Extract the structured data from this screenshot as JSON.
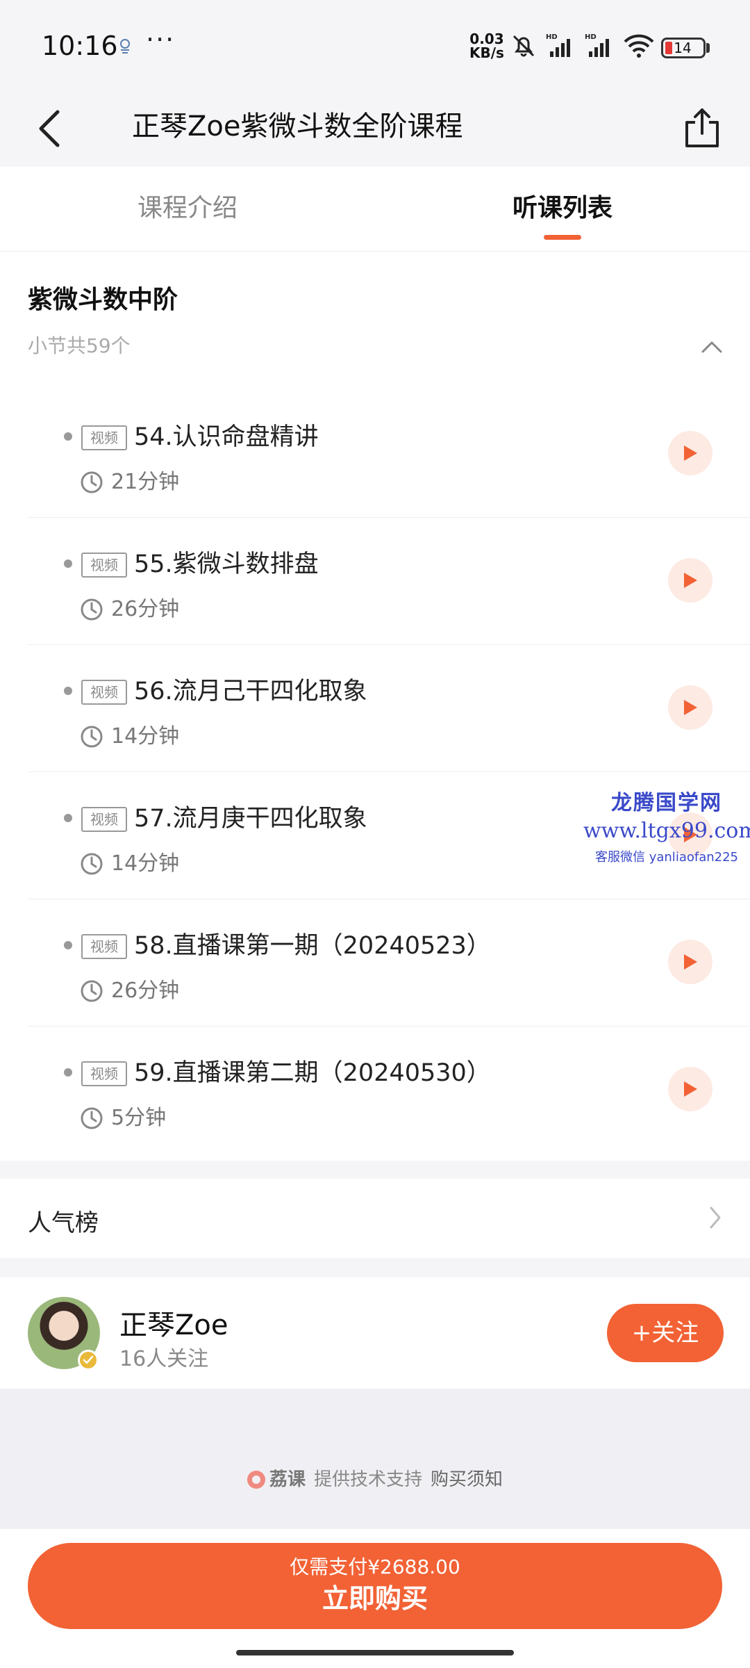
{
  "status_bar": {
    "time": "10:16",
    "more": "···",
    "net_speed_value": "0.03",
    "net_speed_unit": "KB/s",
    "battery": "14",
    "icons": [
      "weather-icon",
      "mute-bell-icon",
      "hd-signal-icon",
      "hd-signal-icon",
      "wifi-icon",
      "battery-icon"
    ]
  },
  "header": {
    "title": "正琴Zoe紫微斗数全阶课程"
  },
  "tabs": [
    {
      "label": "课程介绍",
      "active": false
    },
    {
      "label": "听课列表",
      "active": true
    }
  ],
  "chapter": {
    "title": "紫微斗数中阶",
    "count": "小节共59个",
    "lessons": [
      {
        "tag": "视频",
        "title": "54.认识命盘精讲",
        "duration": "21分钟"
      },
      {
        "tag": "视频",
        "title": "55.紫微斗数排盘",
        "duration": "26分钟"
      },
      {
        "tag": "视频",
        "title": "56.流月己干四化取象",
        "duration": "14分钟"
      },
      {
        "tag": "视频",
        "title": "57.流月庚干四化取象",
        "duration": "14分钟"
      },
      {
        "tag": "视频",
        "title": "58.直播课第一期（20240523）",
        "duration": "26分钟"
      },
      {
        "tag": "视频",
        "title": "59.直播课第二期（20240530）",
        "duration": "5分钟"
      }
    ]
  },
  "watermark": {
    "line1": "龙腾国学网",
    "line2": "www.ltgx99.com",
    "line3": "客服微信 yanliaofan225"
  },
  "popular": {
    "label": "人气榜"
  },
  "author": {
    "name": "正琴Zoe",
    "followers": "16人关注",
    "follow_label": "+关注"
  },
  "support": {
    "brand": "荔课",
    "text": "提供技术支持",
    "link": "购买须知"
  },
  "buy": {
    "price": "仅需支付¥2688.00",
    "label": "立即购买"
  },
  "colors": {
    "accent": "#f26235",
    "watermark": "#3a49c9"
  }
}
